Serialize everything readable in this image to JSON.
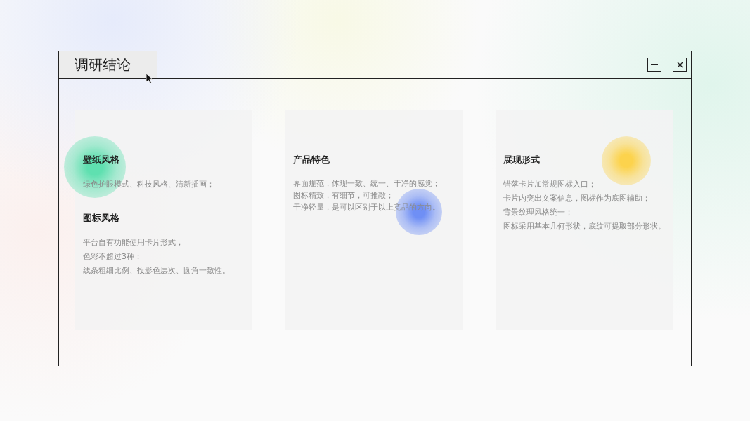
{
  "window": {
    "title": "调研结论"
  },
  "cards": [
    {
      "color": "#5fe0b0",
      "sections": [
        {
          "heading": "壁纸风格",
          "lines": [
            "绿色护眼模式、科技风格、清新插画；"
          ]
        },
        {
          "heading": "图标风格",
          "lines": [
            "平台自有功能使用卡片形式，",
            "色彩不超过3种；",
            "线条粗细比例、投影色层次、圆角一致性。"
          ]
        }
      ]
    },
    {
      "color": "#6f8ff5",
      "sections": [
        {
          "heading": "产品特色",
          "lines": [
            "界面规范，体现一致、统一、干净的感觉；",
            "图标精致，有细节，可推敲；",
            "干净轻量，是可以区别于以上竞品的方向。"
          ]
        }
      ]
    },
    {
      "color": "#fcd34d",
      "sections": [
        {
          "heading": "展现形式",
          "lines": [
            "错落卡片加常规图标入口；",
            "卡片内突出文案信息，图标作为底图辅助；",
            "背景纹理风格统一；",
            "图标采用基本几何形状，底纹可提取部分形状。"
          ]
        }
      ]
    }
  ]
}
